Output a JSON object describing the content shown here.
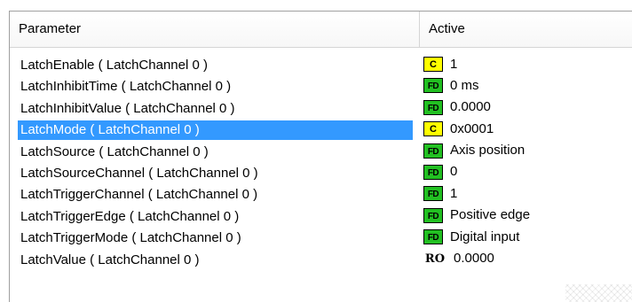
{
  "columns": {
    "parameter": "Parameter",
    "active": "Active"
  },
  "rows": [
    {
      "parameter": "LatchEnable ( LatchChannel 0 )",
      "badge": "C",
      "badge_type": "c",
      "value": "1",
      "selected": false
    },
    {
      "parameter": "LatchInhibitTime ( LatchChannel 0 )",
      "badge": "FD",
      "badge_type": "fd",
      "value": "0 ms",
      "selected": false
    },
    {
      "parameter": "LatchInhibitValue ( LatchChannel 0 )",
      "badge": "FD",
      "badge_type": "fd",
      "value": "0.0000",
      "selected": false
    },
    {
      "parameter": "LatchMode ( LatchChannel 0 )",
      "badge": "C",
      "badge_type": "c",
      "value": "0x0001",
      "selected": true
    },
    {
      "parameter": "LatchSource ( LatchChannel 0 )",
      "badge": "FD",
      "badge_type": "fd",
      "value": "Axis position",
      "selected": false
    },
    {
      "parameter": "LatchSourceChannel ( LatchChannel 0 )",
      "badge": "FD",
      "badge_type": "fd",
      "value": "0",
      "selected": false
    },
    {
      "parameter": "LatchTriggerChannel ( LatchChannel 0 )",
      "badge": "FD",
      "badge_type": "fd",
      "value": "1",
      "selected": false
    },
    {
      "parameter": "LatchTriggerEdge ( LatchChannel 0 )",
      "badge": "FD",
      "badge_type": "fd",
      "value": "Positive edge",
      "selected": false
    },
    {
      "parameter": "LatchTriggerMode ( LatchChannel 0 )",
      "badge": "FD",
      "badge_type": "fd",
      "value": "Digital input",
      "selected": false
    },
    {
      "parameter": "LatchValue ( LatchChannel 0 )",
      "badge": "RO",
      "badge_type": "ro",
      "value": "0.0000",
      "selected": false
    }
  ],
  "colors": {
    "selection": "#3399ff",
    "badge_c": "#ffff00",
    "badge_fd": "#22c022"
  }
}
